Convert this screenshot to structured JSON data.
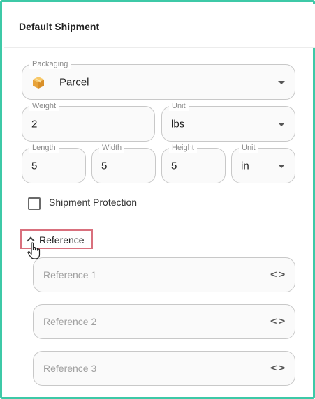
{
  "header": {
    "title": "Default Shipment"
  },
  "packaging": {
    "label": "Packaging",
    "value": "Parcel",
    "icon": "box-icon"
  },
  "weight": {
    "label": "Weight",
    "value": "2"
  },
  "weight_unit": {
    "label": "Unit",
    "value": "lbs"
  },
  "length": {
    "label": "Length",
    "value": "5"
  },
  "width": {
    "label": "Width",
    "value": "5"
  },
  "height": {
    "label": "Height",
    "value": "5"
  },
  "dimension_unit": {
    "label": "Unit",
    "value": "in"
  },
  "shipment_protection": {
    "label": "Shipment Protection",
    "checked": false
  },
  "reference": {
    "toggle_label": "Reference",
    "expanded": true,
    "fields": [
      {
        "placeholder": "Reference 1",
        "icon": "code-brackets-icon"
      },
      {
        "placeholder": "Reference 2",
        "icon": "code-brackets-icon"
      },
      {
        "placeholder": "Reference 3",
        "icon": "code-brackets-icon"
      }
    ]
  },
  "colors": {
    "frame_border": "#3ec9a7",
    "highlight_border": "#d9707d",
    "box_icon": "#f0b44a"
  }
}
